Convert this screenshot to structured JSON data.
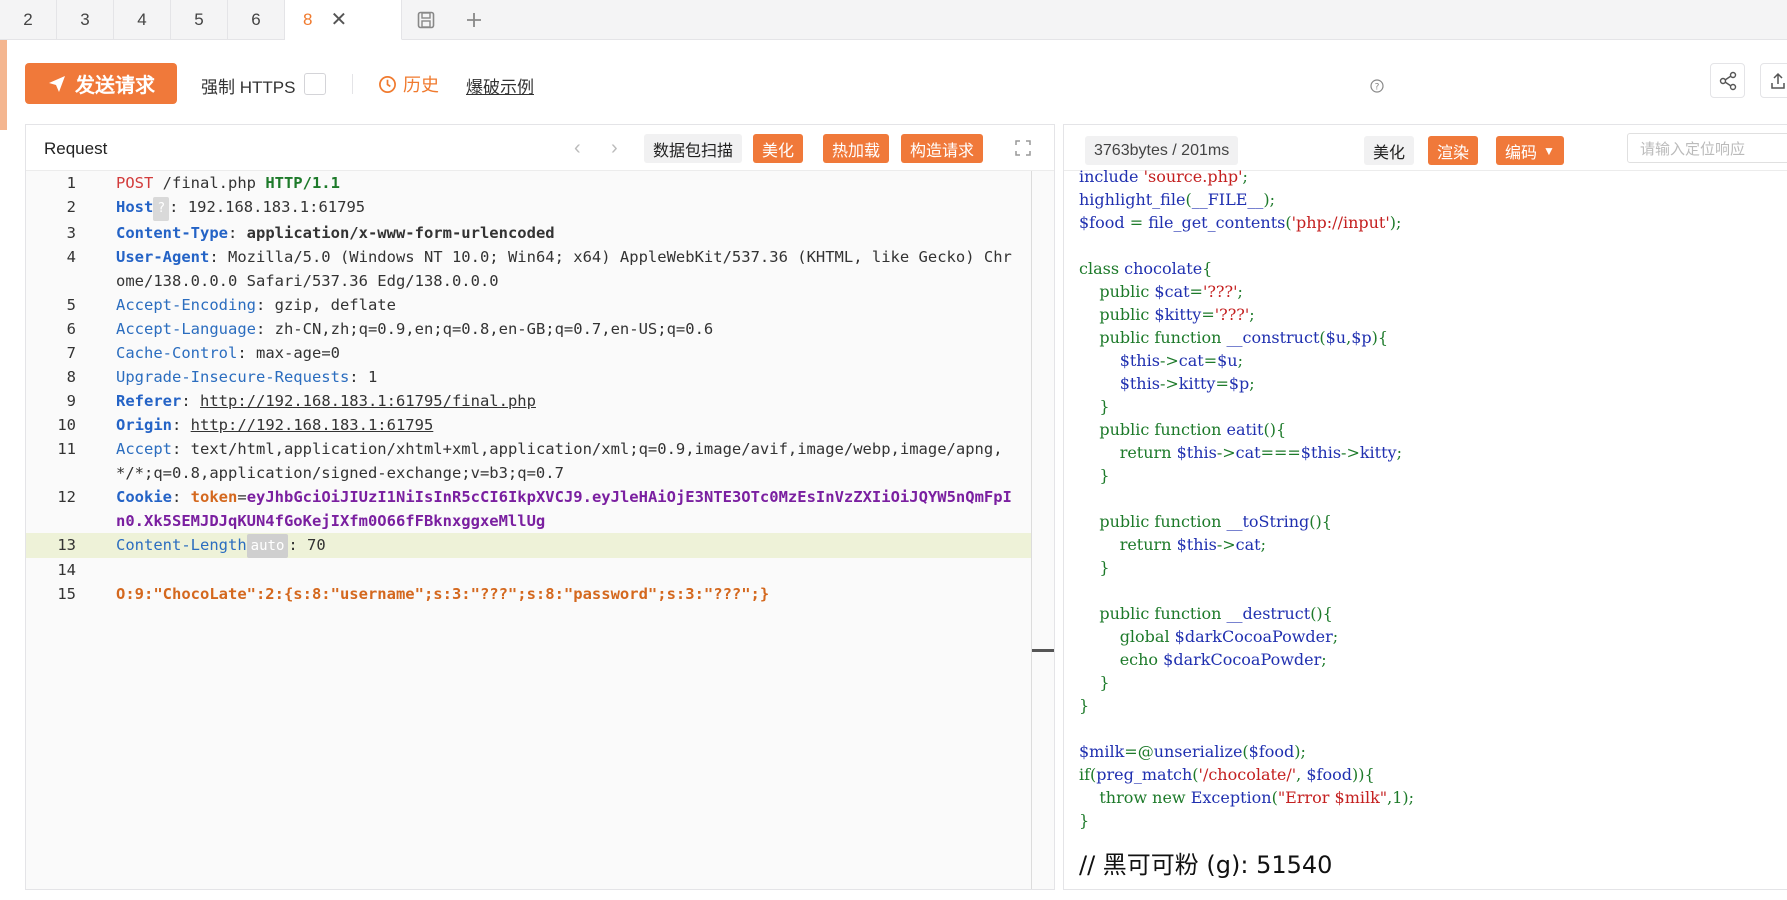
{
  "tabs": [
    {
      "label": "2"
    },
    {
      "label": "3"
    },
    {
      "label": "4"
    },
    {
      "label": "5"
    },
    {
      "label": "6"
    },
    {
      "label": "8",
      "active": true
    }
  ],
  "toolbar": {
    "send_label": "发送请求",
    "https_label": "强制 HTTPS",
    "history_label": "历史",
    "blast_label": "爆破示例"
  },
  "request": {
    "title": "Request",
    "buttons": {
      "scan": "数据包扫描",
      "beautify": "美化",
      "hotload": "热加载",
      "construct": "构造请求"
    },
    "lines": [
      {
        "n": "1",
        "parts": [
          [
            "k-red",
            "POST"
          ],
          [
            "k-val",
            " /final.php "
          ],
          [
            "k-green",
            "HTTP/1.1"
          ]
        ]
      },
      {
        "n": "2",
        "parts": [
          [
            "k-blue",
            "Host"
          ],
          [
            "badge",
            "?"
          ],
          [
            "k-val",
            ": 192.168.183.1:61795"
          ]
        ]
      },
      {
        "n": "3",
        "parts": [
          [
            "k-blue",
            "Content-Type"
          ],
          [
            "k-val",
            ": "
          ],
          [
            "k-val-b",
            "application/x-www-form-urlencoded"
          ]
        ]
      },
      {
        "n": "4",
        "parts": [
          [
            "k-blue",
            "User-Agent"
          ],
          [
            "k-val",
            ": Mozilla/5.0 (Windows NT 10.0; Win64; x64) AppleWebKit/537.36 (KHTML, like Gecko) Chrome/138.0.0.0 Safari/537.36 Edg/138.0.0.0"
          ]
        ]
      },
      {
        "n": "5",
        "parts": [
          [
            "k-blue-n",
            "Accept-Encoding"
          ],
          [
            "k-val",
            ": gzip, deflate"
          ]
        ]
      },
      {
        "n": "6",
        "parts": [
          [
            "k-blue-n",
            "Accept-Language"
          ],
          [
            "k-val",
            ": zh-CN,zh;q=0.9,en;q=0.8,en-GB;q=0.7,en-US;q=0.6"
          ]
        ]
      },
      {
        "n": "7",
        "parts": [
          [
            "k-blue-n",
            "Cache-Control"
          ],
          [
            "k-val",
            ": max-age=0"
          ]
        ]
      },
      {
        "n": "8",
        "parts": [
          [
            "k-blue-n",
            "Upgrade-Insecure-Requests"
          ],
          [
            "k-val",
            ": 1"
          ]
        ]
      },
      {
        "n": "9",
        "parts": [
          [
            "k-blue",
            "Referer"
          ],
          [
            "k-val",
            ": "
          ],
          [
            "k-link",
            "http://192.168.183.1:61795/final.php"
          ]
        ]
      },
      {
        "n": "10",
        "parts": [
          [
            "k-blue",
            "Origin"
          ],
          [
            "k-val",
            ": "
          ],
          [
            "k-link",
            "http://192.168.183.1:61795"
          ]
        ]
      },
      {
        "n": "11",
        "parts": [
          [
            "k-blue-n",
            "Accept"
          ],
          [
            "k-val",
            ": text/html,application/xhtml+xml,application/xml;q=0.9,image/avif,image/webp,image/apng,*/*;q=0.8,application/signed-exchange;v=b3;q=0.7"
          ]
        ]
      },
      {
        "n": "12",
        "parts": [
          [
            "k-blue",
            "Cookie"
          ],
          [
            "k-val",
            ": "
          ],
          [
            "k-orange",
            "token"
          ],
          [
            "k-val",
            "="
          ],
          [
            "k-purple",
            "eyJhbGciOiJIUzI1NiIsInR5cCI6IkpXVCJ9.eyJleHAiOjE3NTE3OTc0MzEsInVzZXIiOiJQYW5nQmFpIn0.Xk5SEMJDJqKUN4fGoKejIXfm0O66fFBknxggxeMllUg"
          ]
        ]
      },
      {
        "n": "13",
        "hl": true,
        "parts": [
          [
            "k-blue-n",
            "Content-Length"
          ],
          [
            "badge-auto",
            "auto"
          ],
          [
            "k-val",
            ": 70"
          ]
        ]
      },
      {
        "n": "14",
        "parts": []
      },
      {
        "n": "15",
        "parts": [
          [
            "k-orange",
            "O:9:\"ChocoLate\":2:{s:8:\"username\";s:3:\"???\";s:8:\"password\";s:3:\"???\";}"
          ]
        ]
      }
    ]
  },
  "response": {
    "size": "3763bytes / 201ms",
    "buttons": {
      "beautify": "美化",
      "render": "渲染",
      "encode": "编码"
    },
    "search_placeholder": "请输入定位响应",
    "lines": [
      [
        [
          "c-blue",
          "include "
        ],
        [
          "c-red",
          "'source.php'"
        ],
        [
          "c-green",
          ";"
        ]
      ],
      [
        [
          "c-blue",
          "highlight_file"
        ],
        [
          "c-green",
          "("
        ],
        [
          "c-blue",
          "__FILE__"
        ],
        [
          "c-green",
          ");"
        ]
      ],
      [
        [
          "c-blue",
          "$food "
        ],
        [
          "c-green",
          "= "
        ],
        [
          "c-blue",
          "file_get_contents"
        ],
        [
          "c-green",
          "("
        ],
        [
          "c-red",
          "'php://input'"
        ],
        [
          "c-green",
          ");"
        ]
      ],
      [],
      [
        [
          "c-green",
          "class "
        ],
        [
          "c-blue",
          "chocolate"
        ],
        [
          "c-green",
          "{"
        ]
      ],
      [
        [
          "c-green",
          "    public "
        ],
        [
          "c-blue",
          "$cat"
        ],
        [
          "c-green",
          "="
        ],
        [
          "c-red",
          "'???'"
        ],
        [
          "c-green",
          ";"
        ]
      ],
      [
        [
          "c-green",
          "    public "
        ],
        [
          "c-blue",
          "$kitty"
        ],
        [
          "c-green",
          "="
        ],
        [
          "c-red",
          "'???'"
        ],
        [
          "c-green",
          ";"
        ]
      ],
      [
        [
          "c-green",
          "    public function "
        ],
        [
          "c-blue",
          "__construct"
        ],
        [
          "c-green",
          "("
        ],
        [
          "c-blue",
          "$u"
        ],
        [
          "c-green",
          ","
        ],
        [
          "c-blue",
          "$p"
        ],
        [
          "c-green",
          "){"
        ]
      ],
      [
        [
          "c-blue",
          "        $this"
        ],
        [
          "c-green",
          "->"
        ],
        [
          "c-blue",
          "cat"
        ],
        [
          "c-green",
          "="
        ],
        [
          "c-blue",
          "$u"
        ],
        [
          "c-green",
          ";"
        ]
      ],
      [
        [
          "c-blue",
          "        $this"
        ],
        [
          "c-green",
          "->"
        ],
        [
          "c-blue",
          "kitty"
        ],
        [
          "c-green",
          "="
        ],
        [
          "c-blue",
          "$p"
        ],
        [
          "c-green",
          ";"
        ]
      ],
      [
        [
          "c-green",
          "    }"
        ]
      ],
      [
        [
          "c-green",
          "    public function "
        ],
        [
          "c-blue",
          "eatit"
        ],
        [
          "c-green",
          "(){"
        ]
      ],
      [
        [
          "c-green",
          "        return "
        ],
        [
          "c-blue",
          "$this"
        ],
        [
          "c-green",
          "->"
        ],
        [
          "c-blue",
          "cat"
        ],
        [
          "c-green",
          "==="
        ],
        [
          "c-blue",
          "$this"
        ],
        [
          "c-green",
          "->"
        ],
        [
          "c-blue",
          "kitty"
        ],
        [
          "c-green",
          ";"
        ]
      ],
      [
        [
          "c-green",
          "    }"
        ]
      ],
      [],
      [
        [
          "c-green",
          "    public function "
        ],
        [
          "c-blue",
          "__toString"
        ],
        [
          "c-green",
          "(){"
        ]
      ],
      [
        [
          "c-green",
          "        return "
        ],
        [
          "c-blue",
          "$this"
        ],
        [
          "c-green",
          "->"
        ],
        [
          "c-blue",
          "cat"
        ],
        [
          "c-green",
          ";"
        ]
      ],
      [
        [
          "c-green",
          "    }"
        ]
      ],
      [],
      [
        [
          "c-green",
          "    public function "
        ],
        [
          "c-blue",
          "__destruct"
        ],
        [
          "c-green",
          "(){"
        ]
      ],
      [
        [
          "c-green",
          "        global "
        ],
        [
          "c-blue",
          "$darkCocoaPowder"
        ],
        [
          "c-green",
          ";"
        ]
      ],
      [
        [
          "c-green",
          "        echo "
        ],
        [
          "c-blue",
          "$darkCocoaPowder"
        ],
        [
          "c-green",
          ";"
        ]
      ],
      [
        [
          "c-green",
          "    }"
        ]
      ],
      [
        [
          "c-green",
          "}"
        ]
      ],
      [],
      [
        [
          "c-blue",
          "$milk"
        ],
        [
          "c-green",
          "=@"
        ],
        [
          "c-blue",
          "unserialize"
        ],
        [
          "c-green",
          "("
        ],
        [
          "c-blue",
          "$food"
        ],
        [
          "c-green",
          ");"
        ]
      ],
      [
        [
          "c-green",
          "if("
        ],
        [
          "c-blue",
          "preg_match"
        ],
        [
          "c-green",
          "("
        ],
        [
          "c-red",
          "'/chocolate/'"
        ],
        [
          "c-green",
          ", "
        ],
        [
          "c-blue",
          "$food"
        ],
        [
          "c-green",
          ")){"
        ]
      ],
      [
        [
          "c-green",
          "    throw new "
        ],
        [
          "c-blue",
          "Exception"
        ],
        [
          "c-green",
          "("
        ],
        [
          "c-red",
          "\"Error $milk\""
        ],
        [
          "c-green",
          ",1);"
        ]
      ],
      [
        [
          "c-green",
          "}"
        ]
      ]
    ],
    "footer": "// 黑可可粉 (g): 51540"
  }
}
